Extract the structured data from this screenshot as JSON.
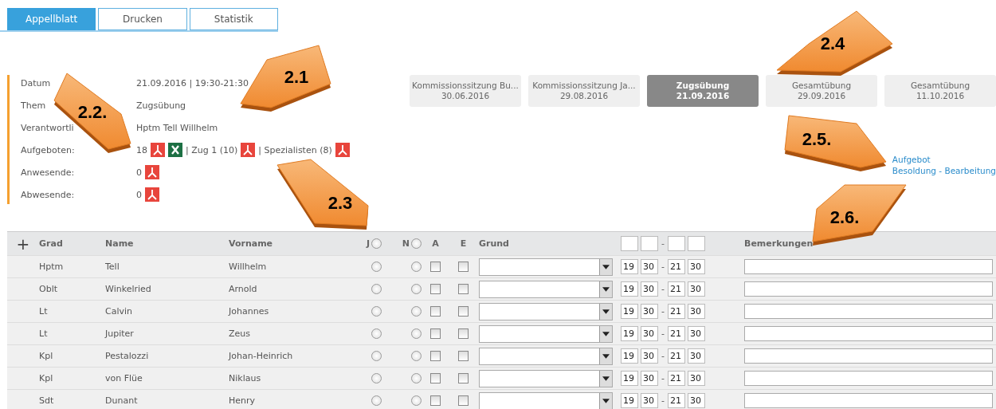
{
  "tabs": [
    {
      "label": "Appellblatt",
      "selected": true
    },
    {
      "label": "Drucken",
      "selected": false
    },
    {
      "label": "Statistik",
      "selected": false
    }
  ],
  "info": [
    {
      "label": "Datum",
      "items": [
        {
          "kind": "text",
          "text": "21.09.2016 | 19:30-21:30"
        }
      ]
    },
    {
      "label": "Them",
      "items": [
        {
          "kind": "text",
          "text": "Zugsübung"
        }
      ]
    },
    {
      "label": "Verantwortli",
      "items": [
        {
          "kind": "text",
          "text": "Hptm Tell Willhelm"
        }
      ]
    },
    {
      "label": "Aufgeboten:",
      "items": [
        {
          "kind": "text",
          "text": "18"
        },
        {
          "kind": "pdf"
        },
        {
          "kind": "excel"
        },
        {
          "kind": "text",
          "text": "| Zug 1 (10)"
        },
        {
          "kind": "pdf"
        },
        {
          "kind": "text",
          "text": "| Spezialisten (8)"
        },
        {
          "kind": "pdf"
        }
      ]
    },
    {
      "label": "Anwesende:",
      "items": [
        {
          "kind": "text",
          "text": "0"
        },
        {
          "kind": "pdf"
        }
      ]
    },
    {
      "label": "Abwesende:",
      "items": [
        {
          "kind": "text",
          "text": "0"
        },
        {
          "kind": "pdf"
        }
      ]
    }
  ],
  "events": [
    {
      "title": "Kommissionssitzung Bu...",
      "date": "30.06.2016",
      "selected": false
    },
    {
      "title": "Kommissionssitzung Ja...",
      "date": "29.08.2016",
      "selected": false
    },
    {
      "title": "Zugsübung",
      "date": "21.09.2016",
      "selected": true
    },
    {
      "title": "Gesamtübung",
      "date": "29.09.2016",
      "selected": false
    },
    {
      "title": "Gesamtübung",
      "date": "11.10.2016",
      "selected": false
    }
  ],
  "links": [
    "Aufgebot",
    "Besoldung - Bearbeitung"
  ],
  "table": {
    "header": {
      "add": "+",
      "grad": "Grad",
      "name": "Name",
      "vorname": "Vorname",
      "j": "J",
      "j_selected": false,
      "n": "N",
      "n_selected": false,
      "a": "A",
      "e": "E",
      "grund": "Grund",
      "sep": "-",
      "bemerkungen": "Bemerkungen"
    },
    "rows": [
      {
        "grad": "Hptm",
        "name": "Tell",
        "vorname": "Willhelm",
        "j_selected": false,
        "n_selected": false,
        "a_checked": false,
        "e_checked": false,
        "times": [
          "19",
          "30",
          "21",
          "30"
        ],
        "sep": "-"
      },
      {
        "grad": "Oblt",
        "name": "Winkelried",
        "vorname": "Arnold",
        "j_selected": false,
        "n_selected": false,
        "a_checked": false,
        "e_checked": false,
        "times": [
          "19",
          "30",
          "21",
          "30"
        ],
        "sep": "-"
      },
      {
        "grad": "Lt",
        "name": "Calvin",
        "vorname": "Johannes",
        "j_selected": false,
        "n_selected": false,
        "a_checked": false,
        "e_checked": false,
        "times": [
          "19",
          "30",
          "21",
          "30"
        ],
        "sep": "-"
      },
      {
        "grad": "Lt",
        "name": "Jupiter",
        "vorname": "Zeus",
        "j_selected": false,
        "n_selected": false,
        "a_checked": false,
        "e_checked": false,
        "times": [
          "19",
          "30",
          "21",
          "30"
        ],
        "sep": "-"
      },
      {
        "grad": "Kpl",
        "name": "Pestalozzi",
        "vorname": "Johan-Heinrich",
        "j_selected": false,
        "n_selected": false,
        "a_checked": false,
        "e_checked": false,
        "times": [
          "19",
          "30",
          "21",
          "30"
        ],
        "sep": "-"
      },
      {
        "grad": "Kpl",
        "name": "von Flüe",
        "vorname": "Niklaus",
        "j_selected": false,
        "n_selected": false,
        "a_checked": false,
        "e_checked": false,
        "times": [
          "19",
          "30",
          "21",
          "30"
        ],
        "sep": "-"
      },
      {
        "grad": "Sdt",
        "name": "Dunant",
        "vorname": "Henry",
        "j_selected": false,
        "n_selected": false,
        "a_checked": false,
        "e_checked": false,
        "times": [
          "19",
          "30",
          "21",
          "30"
        ],
        "sep": "-"
      }
    ]
  },
  "callouts": [
    "2.1",
    "2.2.",
    "2.3",
    "2.4",
    "2.5.",
    "2.6."
  ]
}
